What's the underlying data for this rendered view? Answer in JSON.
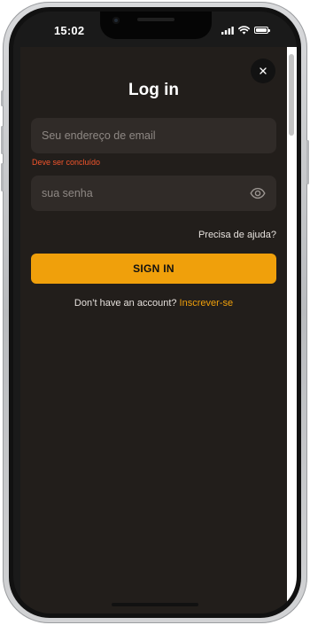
{
  "status_bar": {
    "time": "15:02"
  },
  "login": {
    "title": "Log in",
    "email": {
      "placeholder": "Seu endereço de email",
      "value": "",
      "error": "Deve ser concluído"
    },
    "password": {
      "placeholder": "sua senha",
      "value": ""
    },
    "help_link": "Precisa de ajuda?",
    "sign_in_label": "SIGN IN",
    "signup_prompt": "Don’t have an account?",
    "signup_link": "Inscrever-se"
  },
  "colors": {
    "accent": "#f0a00b",
    "error": "#f2552c",
    "background": "#221e1b",
    "field": "#302b28"
  },
  "icons": {
    "close": "close-icon",
    "eye": "eye-icon",
    "signal": "cellular-signal-icon",
    "wifi": "wifi-icon",
    "battery": "battery-icon"
  }
}
